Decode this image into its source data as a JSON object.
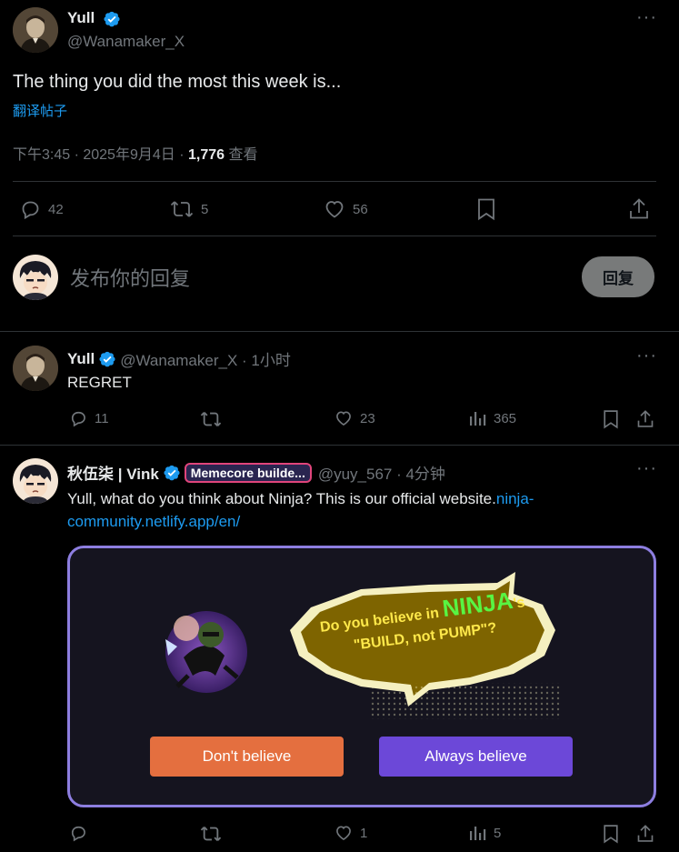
{
  "main_tweet": {
    "author_name": "Yull",
    "handle": "@Wanamaker_X",
    "text": "The thing you did the most this week is...",
    "translate_label": "翻译帖子",
    "timestamp": "下午3:45 · 2025年9月4日 · ",
    "views_count": "1,776",
    "views_label": "查看",
    "reply_count": "42",
    "retweet_count": "5",
    "like_count": "56"
  },
  "compose": {
    "placeholder": "发布你的回复",
    "reply_button": "回复"
  },
  "replies": [
    {
      "author_name": "Yull",
      "handle_time": "@Wanamaker_X · 1小时",
      "text": "REGRET",
      "reply_count": "11",
      "like_count": "23",
      "view_count": "365"
    },
    {
      "author_name": "秋伍柒 | Vink",
      "badge": "Memecore builde...",
      "handle_time": "@yuy_567 · 4分钟",
      "text": "Yull, what do you think about Ninja? This is our official website.",
      "link": "ninja-community.netlify.app/en/",
      "like_count": "1",
      "view_count": "5",
      "card": {
        "bubble_line1_prefix": "Do you believe in ",
        "bubble_highlight": "NINJA",
        "bubble_line1_suffix": "'s",
        "bubble_line2": "\"BUILD, not PUMP\"?",
        "button_left": "Don't believe",
        "button_right": "Always believe"
      }
    }
  ],
  "colors": {
    "accent": "#1d9bf0",
    "card_border": "#8d7ee0",
    "button_orange": "#e46f3f",
    "button_purple": "#6c48d8",
    "bubble_fill": "#7e6400",
    "bubble_text": "#ffe94a",
    "ninja_green": "#58f542"
  }
}
